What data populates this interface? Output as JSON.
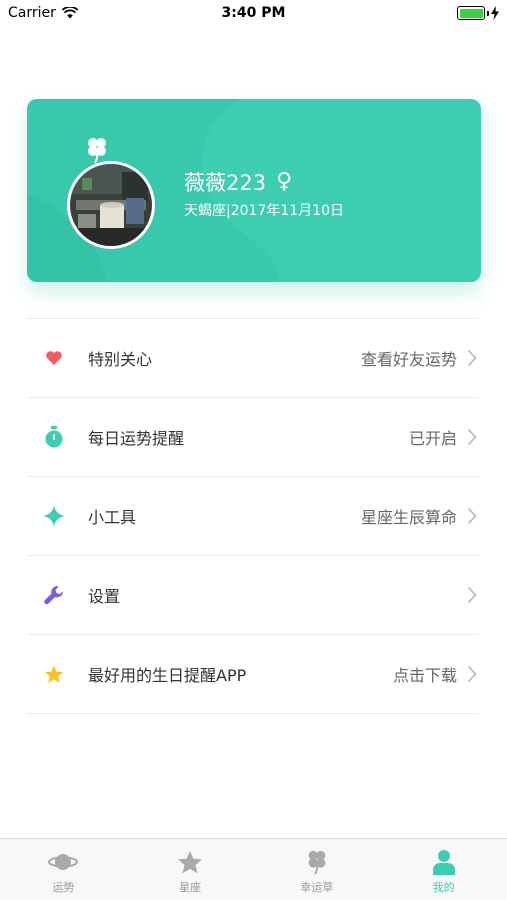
{
  "status_bar": {
    "carrier": "Carrier",
    "time": "3:40 PM"
  },
  "profile": {
    "username": "薇薇223",
    "gender_symbol": "♀",
    "birth_info": "天蝎座|2017年11月10日"
  },
  "menu": [
    {
      "label": "特别关心",
      "value": "查看好友运势",
      "icon": "heart-icon",
      "color": "#f25e5e"
    },
    {
      "label": "每日运势提醒",
      "value": "已开启",
      "icon": "stopwatch-icon",
      "color": "#3dcdb0"
    },
    {
      "label": "小工具",
      "value": "星座生辰算命",
      "icon": "sparkle-icon",
      "color": "#3dcdb0"
    },
    {
      "label": "设置",
      "value": "",
      "icon": "wrench-icon",
      "color": "#7a5ce0"
    },
    {
      "label": "最好用的生日提醒APP",
      "value": "点击下载",
      "icon": "star-icon",
      "color": "#f7c325"
    }
  ],
  "tabs": [
    {
      "label": "运势",
      "icon": "planet-icon",
      "active": false
    },
    {
      "label": "星座",
      "icon": "star-icon",
      "active": false
    },
    {
      "label": "幸运草",
      "icon": "clover-icon",
      "active": false
    },
    {
      "label": "我的",
      "icon": "person-icon",
      "active": true
    }
  ],
  "colors": {
    "accent": "#3dcdb0",
    "inactive": "#a9a9a9"
  }
}
